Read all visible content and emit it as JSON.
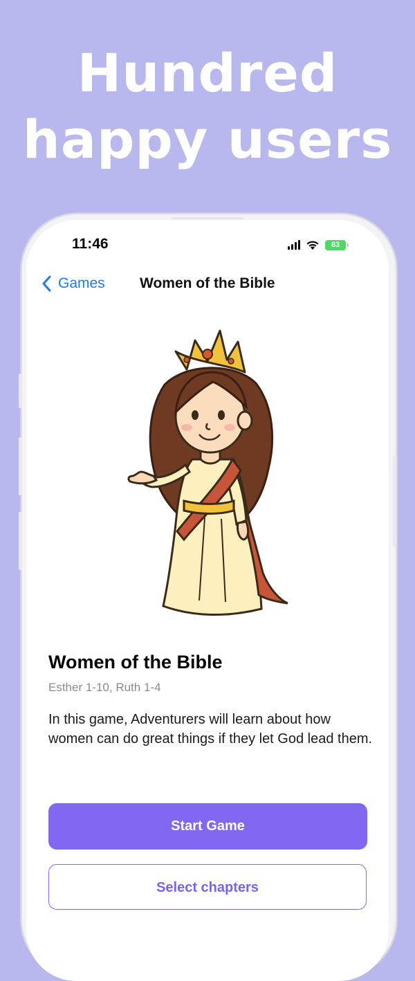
{
  "promo": {
    "headline_line1": "Hundred",
    "headline_line2": "happy users",
    "background_color": "#b8b8ee"
  },
  "status_bar": {
    "time": "11:46",
    "battery": "63",
    "icons": [
      "signal-icon",
      "wifi-icon",
      "battery-charging-icon"
    ]
  },
  "nav": {
    "back_label": "Games",
    "title": "Women of the Bible"
  },
  "game": {
    "title": "Women of the Bible",
    "chapters": "Esther 1-10, Ruth 1-4",
    "description": "In this game, Adventurers will learn about how women can do great things if they let God lead them."
  },
  "buttons": {
    "start": "Start Game",
    "select": "Select chapters"
  },
  "colors": {
    "accent": "#8068f0",
    "link": "#1a7cf0",
    "battery": "#4cd964"
  }
}
